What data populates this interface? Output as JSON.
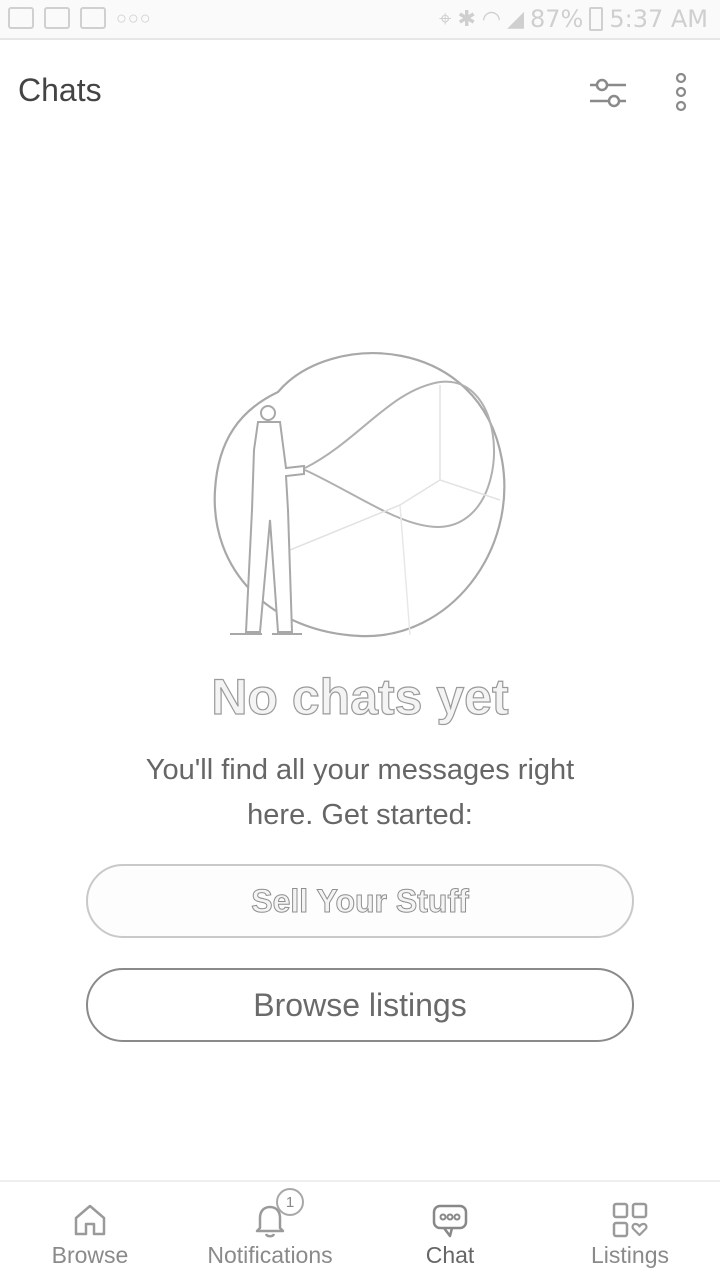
{
  "status_bar": {
    "battery": "87%",
    "time": "5:37 AM",
    "left_icons": [
      "message-icon",
      "checklist-icon",
      "gmail-icon"
    ],
    "right_icons": [
      "location-icon",
      "bluetooth-icon",
      "wifi-icon",
      "signal-icon",
      "battery-icon"
    ]
  },
  "header": {
    "title": "Chats",
    "filter_icon": "sliders-icon",
    "menu_icon": "more-vertical-icon"
  },
  "empty_state": {
    "title": "No chats yet",
    "description": "You'll find all your messages right here. Get started:",
    "primary_button": "Sell Your Stuff",
    "secondary_button": "Browse listings"
  },
  "bottom_nav": {
    "items": [
      {
        "label": "Browse",
        "icon": "home-icon",
        "active": false
      },
      {
        "label": "Notifications",
        "icon": "bell-icon",
        "active": false,
        "badge": "1"
      },
      {
        "label": "Chat",
        "icon": "chat-bubble-icon",
        "active": true
      },
      {
        "label": "Listings",
        "icon": "grid-heart-icon",
        "active": false
      }
    ]
  }
}
